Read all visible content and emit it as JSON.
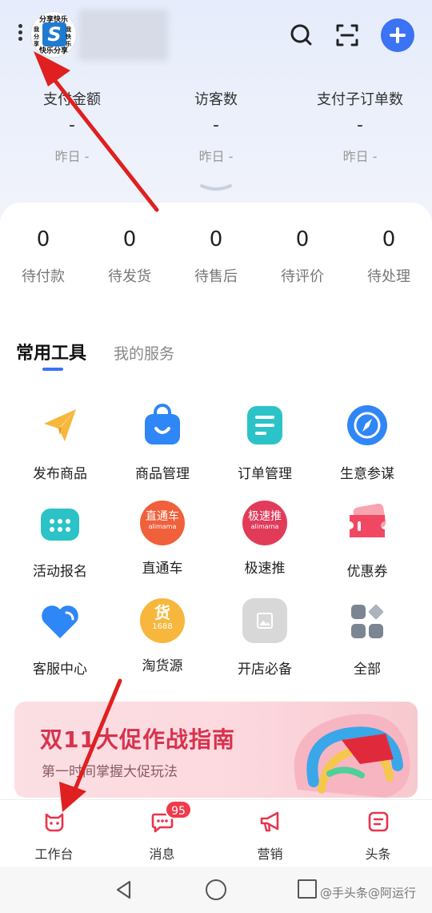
{
  "header": {
    "logo": {
      "top": "分享快乐",
      "bottom": "快乐分享",
      "letter": "S",
      "left": "我分享",
      "right": "我快乐"
    },
    "shop_name": "",
    "icons": [
      "more-icon",
      "search-icon",
      "scan-icon",
      "add-icon"
    ]
  },
  "stats": [
    {
      "label": "支付金额",
      "value": "-",
      "sub": "昨日 -"
    },
    {
      "label": "访客数",
      "value": "-",
      "sub": "昨日 -"
    },
    {
      "label": "支付子订单数",
      "value": "-",
      "sub": "昨日 -"
    }
  ],
  "orders": [
    {
      "count": "0",
      "label": "待付款"
    },
    {
      "count": "0",
      "label": "待发货"
    },
    {
      "count": "0",
      "label": "待售后"
    },
    {
      "count": "0",
      "label": "待评价"
    },
    {
      "count": "0",
      "label": "待处理"
    }
  ],
  "tabs": {
    "active": "常用工具",
    "other": "我的服务"
  },
  "tools": [
    {
      "name": "发布商品",
      "icon": "paper-plane-icon",
      "color": "#f6b73c"
    },
    {
      "name": "商品管理",
      "icon": "shopping-bag-icon",
      "color": "#2f86f6"
    },
    {
      "name": "订单管理",
      "icon": "order-list-icon",
      "color": "#2cc3c8"
    },
    {
      "name": "生意参谋",
      "icon": "compass-icon",
      "color": "#2f86f6"
    },
    {
      "name": "活动报名",
      "icon": "calendar-icon",
      "color": "#2cc3c8"
    },
    {
      "name": "直通车",
      "icon": "ztc-icon",
      "color": "#f0603a",
      "badge_text": "直通车",
      "badge_sub": "alimama"
    },
    {
      "name": "极速推",
      "icon": "jst-icon",
      "color": "#e23b5a",
      "badge_text": "极速推",
      "badge_sub": "alimama"
    },
    {
      "name": "优惠券",
      "icon": "coupon-icon",
      "color": "#f04863"
    },
    {
      "name": "客服中心",
      "icon": "heart-chat-icon",
      "color": "#2f86f6"
    },
    {
      "name": "淘货源",
      "icon": "taohuoyuan-icon",
      "color": "#f6b73c",
      "badge_text": "货",
      "badge_sub": "1688"
    },
    {
      "name": "开店必备",
      "icon": "image-placeholder-icon",
      "color": "#d8d8d8"
    },
    {
      "name": "全部",
      "icon": "all-apps-icon",
      "color": "#7d8593"
    }
  ],
  "banner": {
    "title": "双11大促作战指南",
    "subtitle": "第一时间掌握大促玩法"
  },
  "bottom_nav": [
    {
      "label": "工作台",
      "icon": "workbench-icon"
    },
    {
      "label": "消息",
      "icon": "message-icon",
      "badge": "95"
    },
    {
      "label": "营销",
      "icon": "megaphone-icon"
    },
    {
      "label": "头条",
      "icon": "headline-icon"
    }
  ],
  "watermark": "@手头条@阿运行",
  "colors": {
    "accent": "#3b73f4",
    "badge": "#ef3b4a",
    "annotation_arrow": "#e02020"
  }
}
